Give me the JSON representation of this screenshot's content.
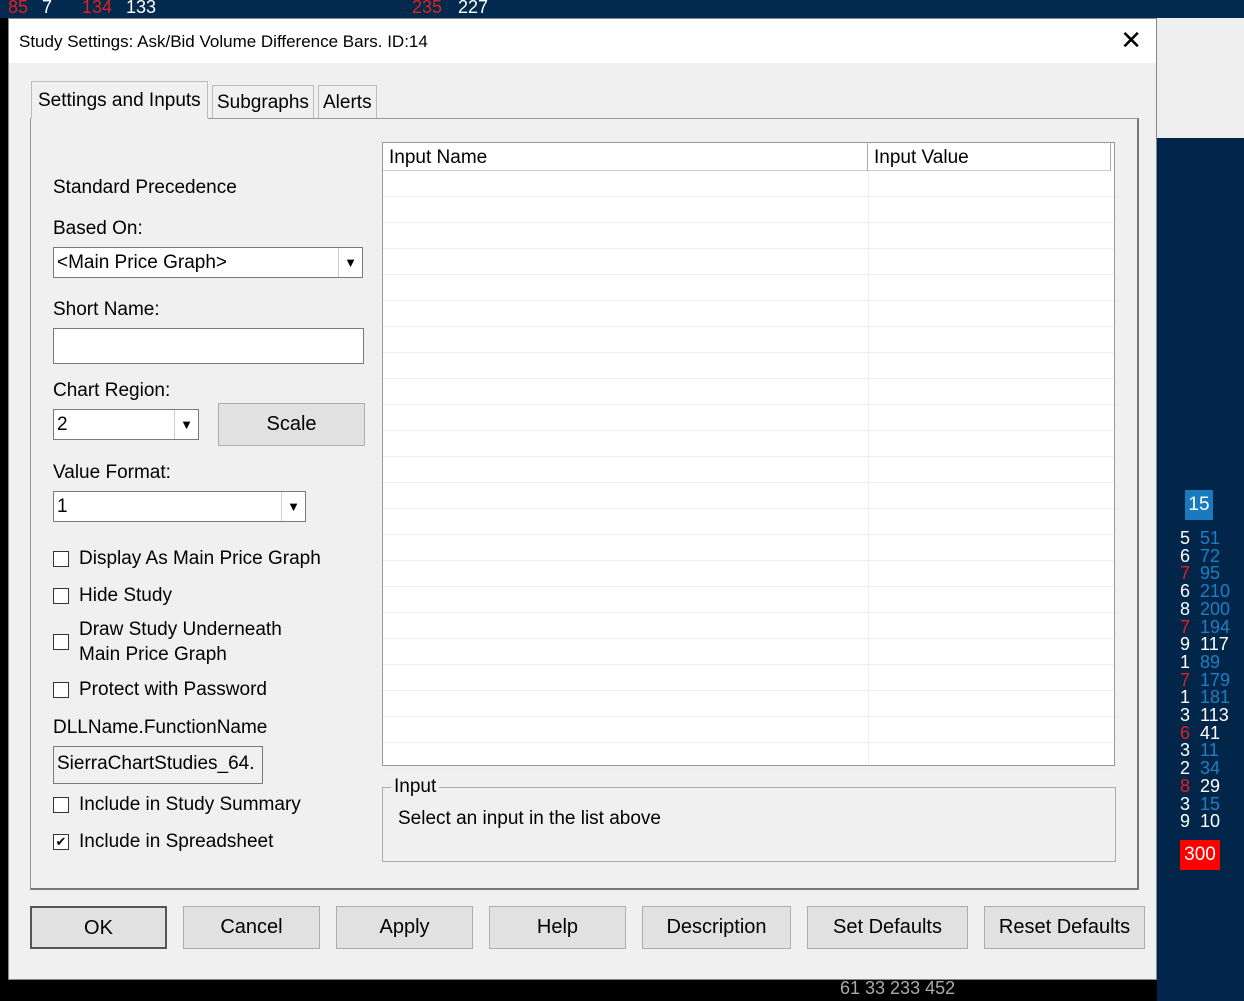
{
  "background": {
    "top_numbers": [
      {
        "t": "85",
        "c": "r"
      },
      {
        "t": "7",
        "c": "w"
      },
      {
        "t": "134",
        "c": "r"
      },
      {
        "t": "133",
        "c": "w"
      },
      {
        "t": "235",
        "c": "r"
      },
      {
        "t": "227",
        "c": "w"
      }
    ],
    "badge_top": "15",
    "badge_bottom": "300",
    "right_rows": [
      [
        "5",
        "51",
        "b"
      ],
      [
        "6",
        "72",
        "b"
      ],
      [
        "7",
        "95",
        "b"
      ],
      [
        "6",
        "210",
        "b"
      ],
      [
        "8",
        "200",
        "b"
      ],
      [
        "7",
        "194",
        "b"
      ],
      [
        "9",
        "117",
        "w"
      ],
      [
        "1",
        "89",
        "b"
      ],
      [
        "7",
        "179",
        "b"
      ],
      [
        "1",
        "181",
        "b"
      ],
      [
        "3",
        "113",
        "w"
      ],
      [
        "6",
        "41",
        "w"
      ],
      [
        "3",
        "11",
        "b"
      ],
      [
        "2",
        "34",
        "b"
      ],
      [
        "8",
        "29",
        "w"
      ],
      [
        "3",
        "15",
        "b"
      ],
      [
        "9",
        "10",
        "w"
      ]
    ],
    "bottom_row": "61  33  233  452"
  },
  "dialog": {
    "title": "Study Settings: Ask/Bid Volume Difference Bars. ID:14",
    "close": "✕",
    "tabs": [
      "Settings and Inputs",
      "Subgraphs",
      "Alerts"
    ],
    "standard_precedence": "Standard Precedence",
    "based_on_label": "Based On:",
    "based_on_value": "<Main Price Graph>",
    "short_name_label": "Short Name:",
    "short_name_value": "",
    "chart_region_label": "Chart Region:",
    "chart_region_value": "2",
    "scale": "Scale",
    "value_format_label": "Value Format:",
    "value_format_value": "1",
    "checkboxes": [
      {
        "label": "Display As Main Price Graph",
        "checked": false
      },
      {
        "label": "Hide Study",
        "checked": false
      },
      {
        "label": "Draw Study Underneath",
        "label2": "Main Price Graph",
        "checked": false
      },
      {
        "label": "Protect with Password",
        "checked": false
      }
    ],
    "dll_label": "DLLName.FunctionName",
    "dll_value": "SierraChartStudies_64.",
    "checkboxes2": [
      {
        "label": "Include in Study Summary",
        "checked": false
      },
      {
        "label": "Include in Spreadsheet",
        "checked": true
      }
    ],
    "columns": [
      "Input Name",
      "Input Value"
    ],
    "input_group": "Input",
    "input_hint": "Select an input in the list above",
    "buttons": [
      "OK",
      "Cancel",
      "Apply",
      "Help",
      "Description",
      "Set Defaults",
      "Reset Defaults"
    ]
  }
}
